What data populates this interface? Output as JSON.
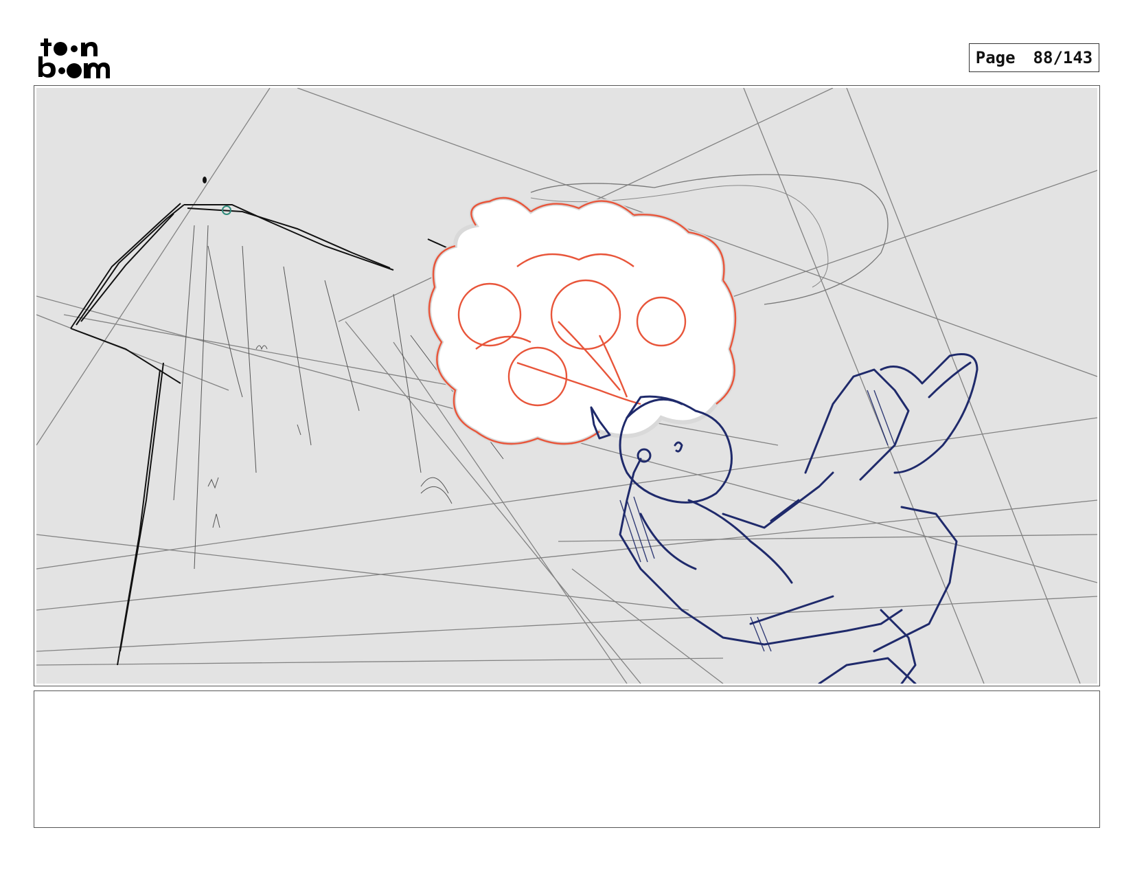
{
  "header": {
    "logo": {
      "line1": "toon",
      "line2": "boom",
      "icon": "toon-boom-logo"
    },
    "page_label": "Page",
    "page_number": "88/143"
  },
  "panel": {
    "image": "storyboard-sketch",
    "background_color": "#e3e3e3",
    "smoke_color": "#e8553a",
    "character_color": "#1f2a6b"
  },
  "notes": {
    "text": ""
  }
}
